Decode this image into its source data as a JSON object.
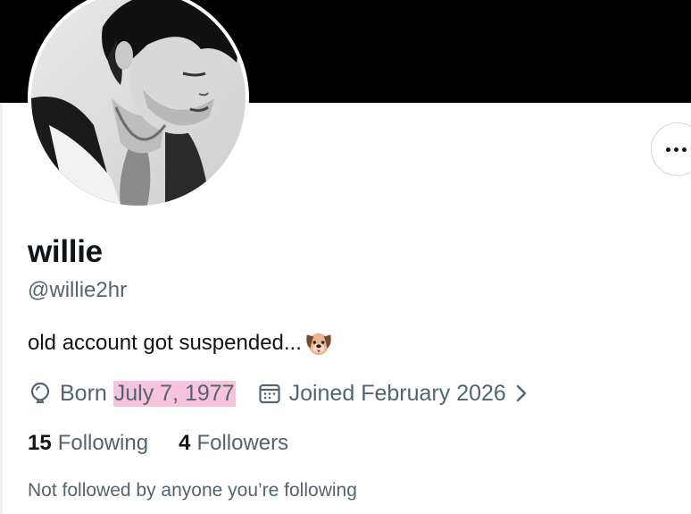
{
  "profile": {
    "display_name": "willie",
    "handle": "@willie2hr",
    "bio_text": "old account got suspended...",
    "bio_emoji": "dog-face-emoji",
    "born_prefix": "Born",
    "born_date": "July 7, 1977",
    "joined": "Joined February 2026",
    "following_count": "15",
    "following_label": "Following",
    "followers_count": "4",
    "followers_label": "Followers",
    "followed_by_note": "Not followed by anyone you’re following"
  },
  "icons": {
    "more": "more-horizontal-icon",
    "birthday": "balloon-icon",
    "joined": "calendar-icon",
    "expand": "chevron-right-icon"
  },
  "colors": {
    "banner": "#000000",
    "primary_text": "#0f1419",
    "secondary_text": "#536471",
    "date_highlight": "#f7c4dc",
    "border": "#cfd9de"
  }
}
